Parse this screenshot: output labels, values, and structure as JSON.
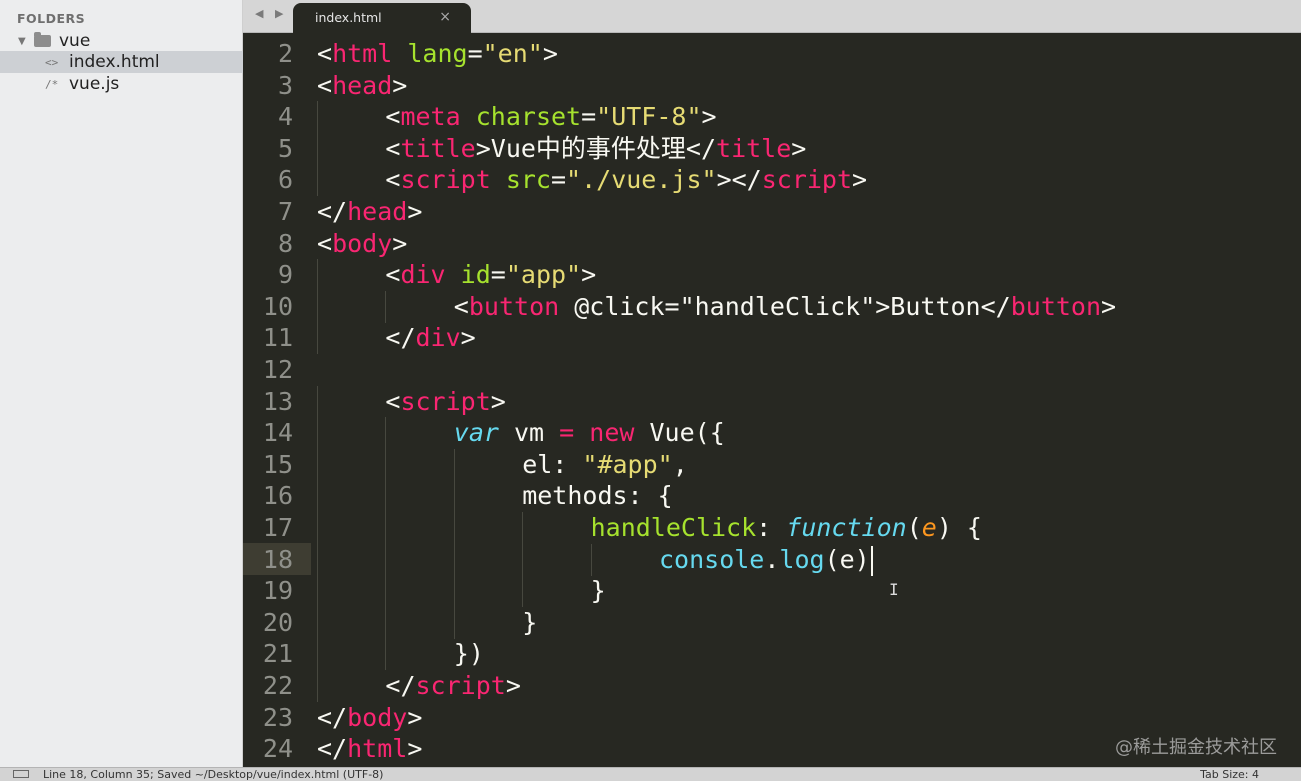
{
  "sidebar": {
    "header": "FOLDERS",
    "folder": {
      "name": "vue",
      "expanded": true,
      "icon": "folder-icon"
    },
    "files": [
      {
        "name": "index.html",
        "icon": "<>",
        "selected": true
      },
      {
        "name": "vue.js",
        "icon": "/*",
        "selected": false
      }
    ]
  },
  "tabs": {
    "nav_arrows": "◀ ▶",
    "active": {
      "label": "index.html",
      "close": "×"
    }
  },
  "editor": {
    "current_line": "18",
    "lines": [
      {
        "n": "2",
        "indent": 0,
        "tokens": [
          [
            "pl",
            "<"
          ],
          [
            "tg",
            "html"
          ],
          [
            "pl",
            " "
          ],
          [
            "at",
            "lang"
          ],
          [
            "pl",
            "="
          ],
          [
            "st",
            "\"en\""
          ],
          [
            "pl",
            ">"
          ]
        ]
      },
      {
        "n": "3",
        "indent": 0,
        "tokens": [
          [
            "pl",
            "<"
          ],
          [
            "tg",
            "head"
          ],
          [
            "pl",
            ">"
          ]
        ]
      },
      {
        "n": "4",
        "indent": 1,
        "tokens": [
          [
            "pl",
            "<"
          ],
          [
            "tg",
            "meta"
          ],
          [
            "pl",
            " "
          ],
          [
            "at",
            "charset"
          ],
          [
            "pl",
            "="
          ],
          [
            "st",
            "\"UTF-8\""
          ],
          [
            "pl",
            ">"
          ]
        ]
      },
      {
        "n": "5",
        "indent": 1,
        "tokens": [
          [
            "pl",
            "<"
          ],
          [
            "tg",
            "title"
          ],
          [
            "pl",
            ">Vue中的事件处理</"
          ],
          [
            "tg",
            "title"
          ],
          [
            "pl",
            ">"
          ]
        ]
      },
      {
        "n": "6",
        "indent": 1,
        "tokens": [
          [
            "pl",
            "<"
          ],
          [
            "tg",
            "script"
          ],
          [
            "pl",
            " "
          ],
          [
            "at",
            "src"
          ],
          [
            "pl",
            "="
          ],
          [
            "st",
            "\"./vue.js\""
          ],
          [
            "pl",
            "></"
          ],
          [
            "tg",
            "script"
          ],
          [
            "pl",
            ">"
          ]
        ]
      },
      {
        "n": "7",
        "indent": 0,
        "tokens": [
          [
            "pl",
            "</"
          ],
          [
            "tg",
            "head"
          ],
          [
            "pl",
            ">"
          ]
        ]
      },
      {
        "n": "8",
        "indent": 0,
        "tokens": [
          [
            "pl",
            "<"
          ],
          [
            "tg",
            "body"
          ],
          [
            "pl",
            ">"
          ]
        ]
      },
      {
        "n": "9",
        "indent": 1,
        "tokens": [
          [
            "pl",
            "<"
          ],
          [
            "tg",
            "div"
          ],
          [
            "pl",
            " "
          ],
          [
            "at",
            "id"
          ],
          [
            "pl",
            "="
          ],
          [
            "st",
            "\"app\""
          ],
          [
            "pl",
            ">"
          ]
        ]
      },
      {
        "n": "10",
        "indent": 2,
        "tokens": [
          [
            "pl",
            "<"
          ],
          [
            "tg",
            "button"
          ],
          [
            "pl",
            " @click=\"handleClick\">Button</"
          ],
          [
            "tg",
            "button"
          ],
          [
            "pl",
            ">"
          ]
        ]
      },
      {
        "n": "11",
        "indent": 1,
        "tokens": [
          [
            "pl",
            "</"
          ],
          [
            "tg",
            "div"
          ],
          [
            "pl",
            ">"
          ]
        ]
      },
      {
        "n": "12",
        "indent": 0,
        "tokens": []
      },
      {
        "n": "13",
        "indent": 1,
        "tokens": [
          [
            "pl",
            "<"
          ],
          [
            "tg",
            "script"
          ],
          [
            "pl",
            ">"
          ]
        ]
      },
      {
        "n": "14",
        "indent": 2,
        "tokens": [
          [
            "kw",
            "var"
          ],
          [
            "pl",
            " vm "
          ],
          [
            "op",
            "="
          ],
          [
            "pl",
            " "
          ],
          [
            "op",
            "new"
          ],
          [
            "pl",
            " Vue({"
          ]
        ]
      },
      {
        "n": "15",
        "indent": 3,
        "tokens": [
          [
            "pl",
            "el: "
          ],
          [
            "st",
            "\"#app\""
          ],
          [
            "pl",
            ","
          ]
        ]
      },
      {
        "n": "16",
        "indent": 3,
        "tokens": [
          [
            "pl",
            "methods: {"
          ]
        ]
      },
      {
        "n": "17",
        "indent": 4,
        "tokens": [
          [
            "fn",
            "handleClick"
          ],
          [
            "pl",
            ": "
          ],
          [
            "kw",
            "function"
          ],
          [
            "pl",
            "("
          ],
          [
            "pa",
            "e"
          ],
          [
            "pl",
            ") {"
          ]
        ]
      },
      {
        "n": "18",
        "indent": 5,
        "tokens": [
          [
            "sc",
            "console"
          ],
          [
            "pl",
            "."
          ],
          [
            "sc",
            "log"
          ],
          [
            "pl",
            "(e)"
          ]
        ]
      },
      {
        "n": "19",
        "indent": 4,
        "tokens": [
          [
            "pl",
            "}"
          ]
        ]
      },
      {
        "n": "20",
        "indent": 3,
        "tokens": [
          [
            "pl",
            "}"
          ]
        ]
      },
      {
        "n": "21",
        "indent": 2,
        "tokens": [
          [
            "pl",
            "})"
          ]
        ]
      },
      {
        "n": "22",
        "indent": 1,
        "tokens": [
          [
            "pl",
            "</"
          ],
          [
            "tg",
            "script"
          ],
          [
            "pl",
            ">"
          ]
        ]
      },
      {
        "n": "23",
        "indent": 0,
        "tokens": [
          [
            "pl",
            "</"
          ],
          [
            "tg",
            "body"
          ],
          [
            "pl",
            ">"
          ]
        ]
      },
      {
        "n": "24",
        "indent": 0,
        "tokens": [
          [
            "pl",
            "</"
          ],
          [
            "tg",
            "html"
          ],
          [
            "pl",
            ">"
          ]
        ]
      }
    ]
  },
  "watermark": "@稀土掘金技术社区",
  "statusbar": {
    "text": "Line 18, Column 35; Saved ~/Desktop/vue/index.html (UTF-8)",
    "tab_size": "Tab Size: 4"
  },
  "colors": {
    "background": "#272822",
    "tag": "#f92672",
    "attribute": "#a6e22e",
    "string": "#e6db74",
    "keyword": "#66d9ef",
    "parameter": "#fd971f",
    "line_number": "#8f908a"
  }
}
